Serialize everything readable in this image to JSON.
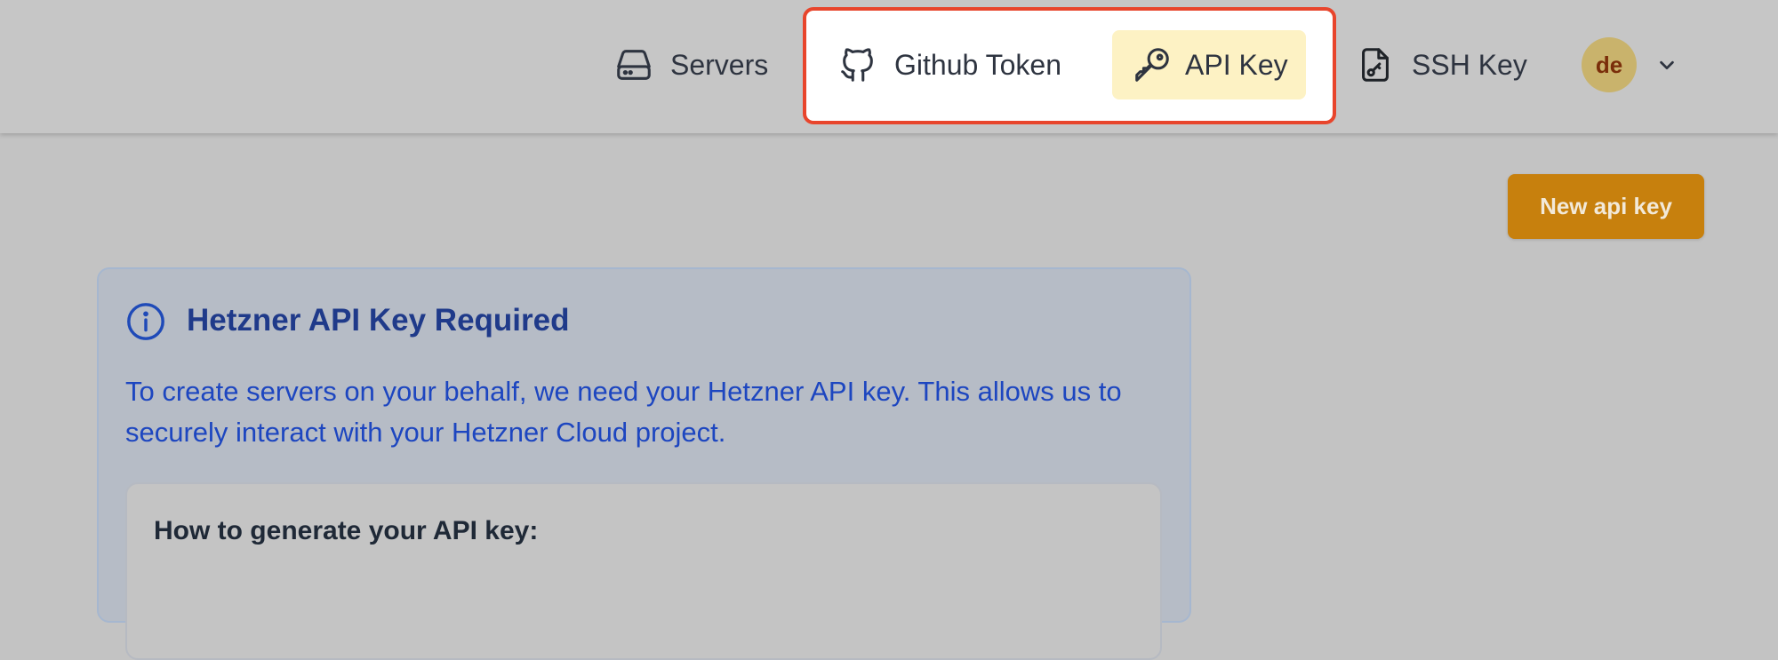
{
  "header": {
    "nav": [
      {
        "label": "Servers",
        "icon": "server-icon"
      },
      {
        "label": "Github Token",
        "icon": "github-icon"
      },
      {
        "label": "API Key",
        "icon": "key-icon",
        "active": true
      },
      {
        "label": "SSH Key",
        "icon": "key-file-icon"
      }
    ],
    "avatar_initials": "de",
    "highlight_color": "#e8452c",
    "active_bg": "#fdf2c4"
  },
  "actions": {
    "new_key_label": "New api key",
    "accent_color": "#c7800d"
  },
  "info": {
    "title": "Hetzner API Key Required",
    "text": "To create servers on your behalf, we need your Hetzner API key. This allows us to securely interact with your Hetzner Cloud project.",
    "steps_title": "How to generate your API key:"
  }
}
